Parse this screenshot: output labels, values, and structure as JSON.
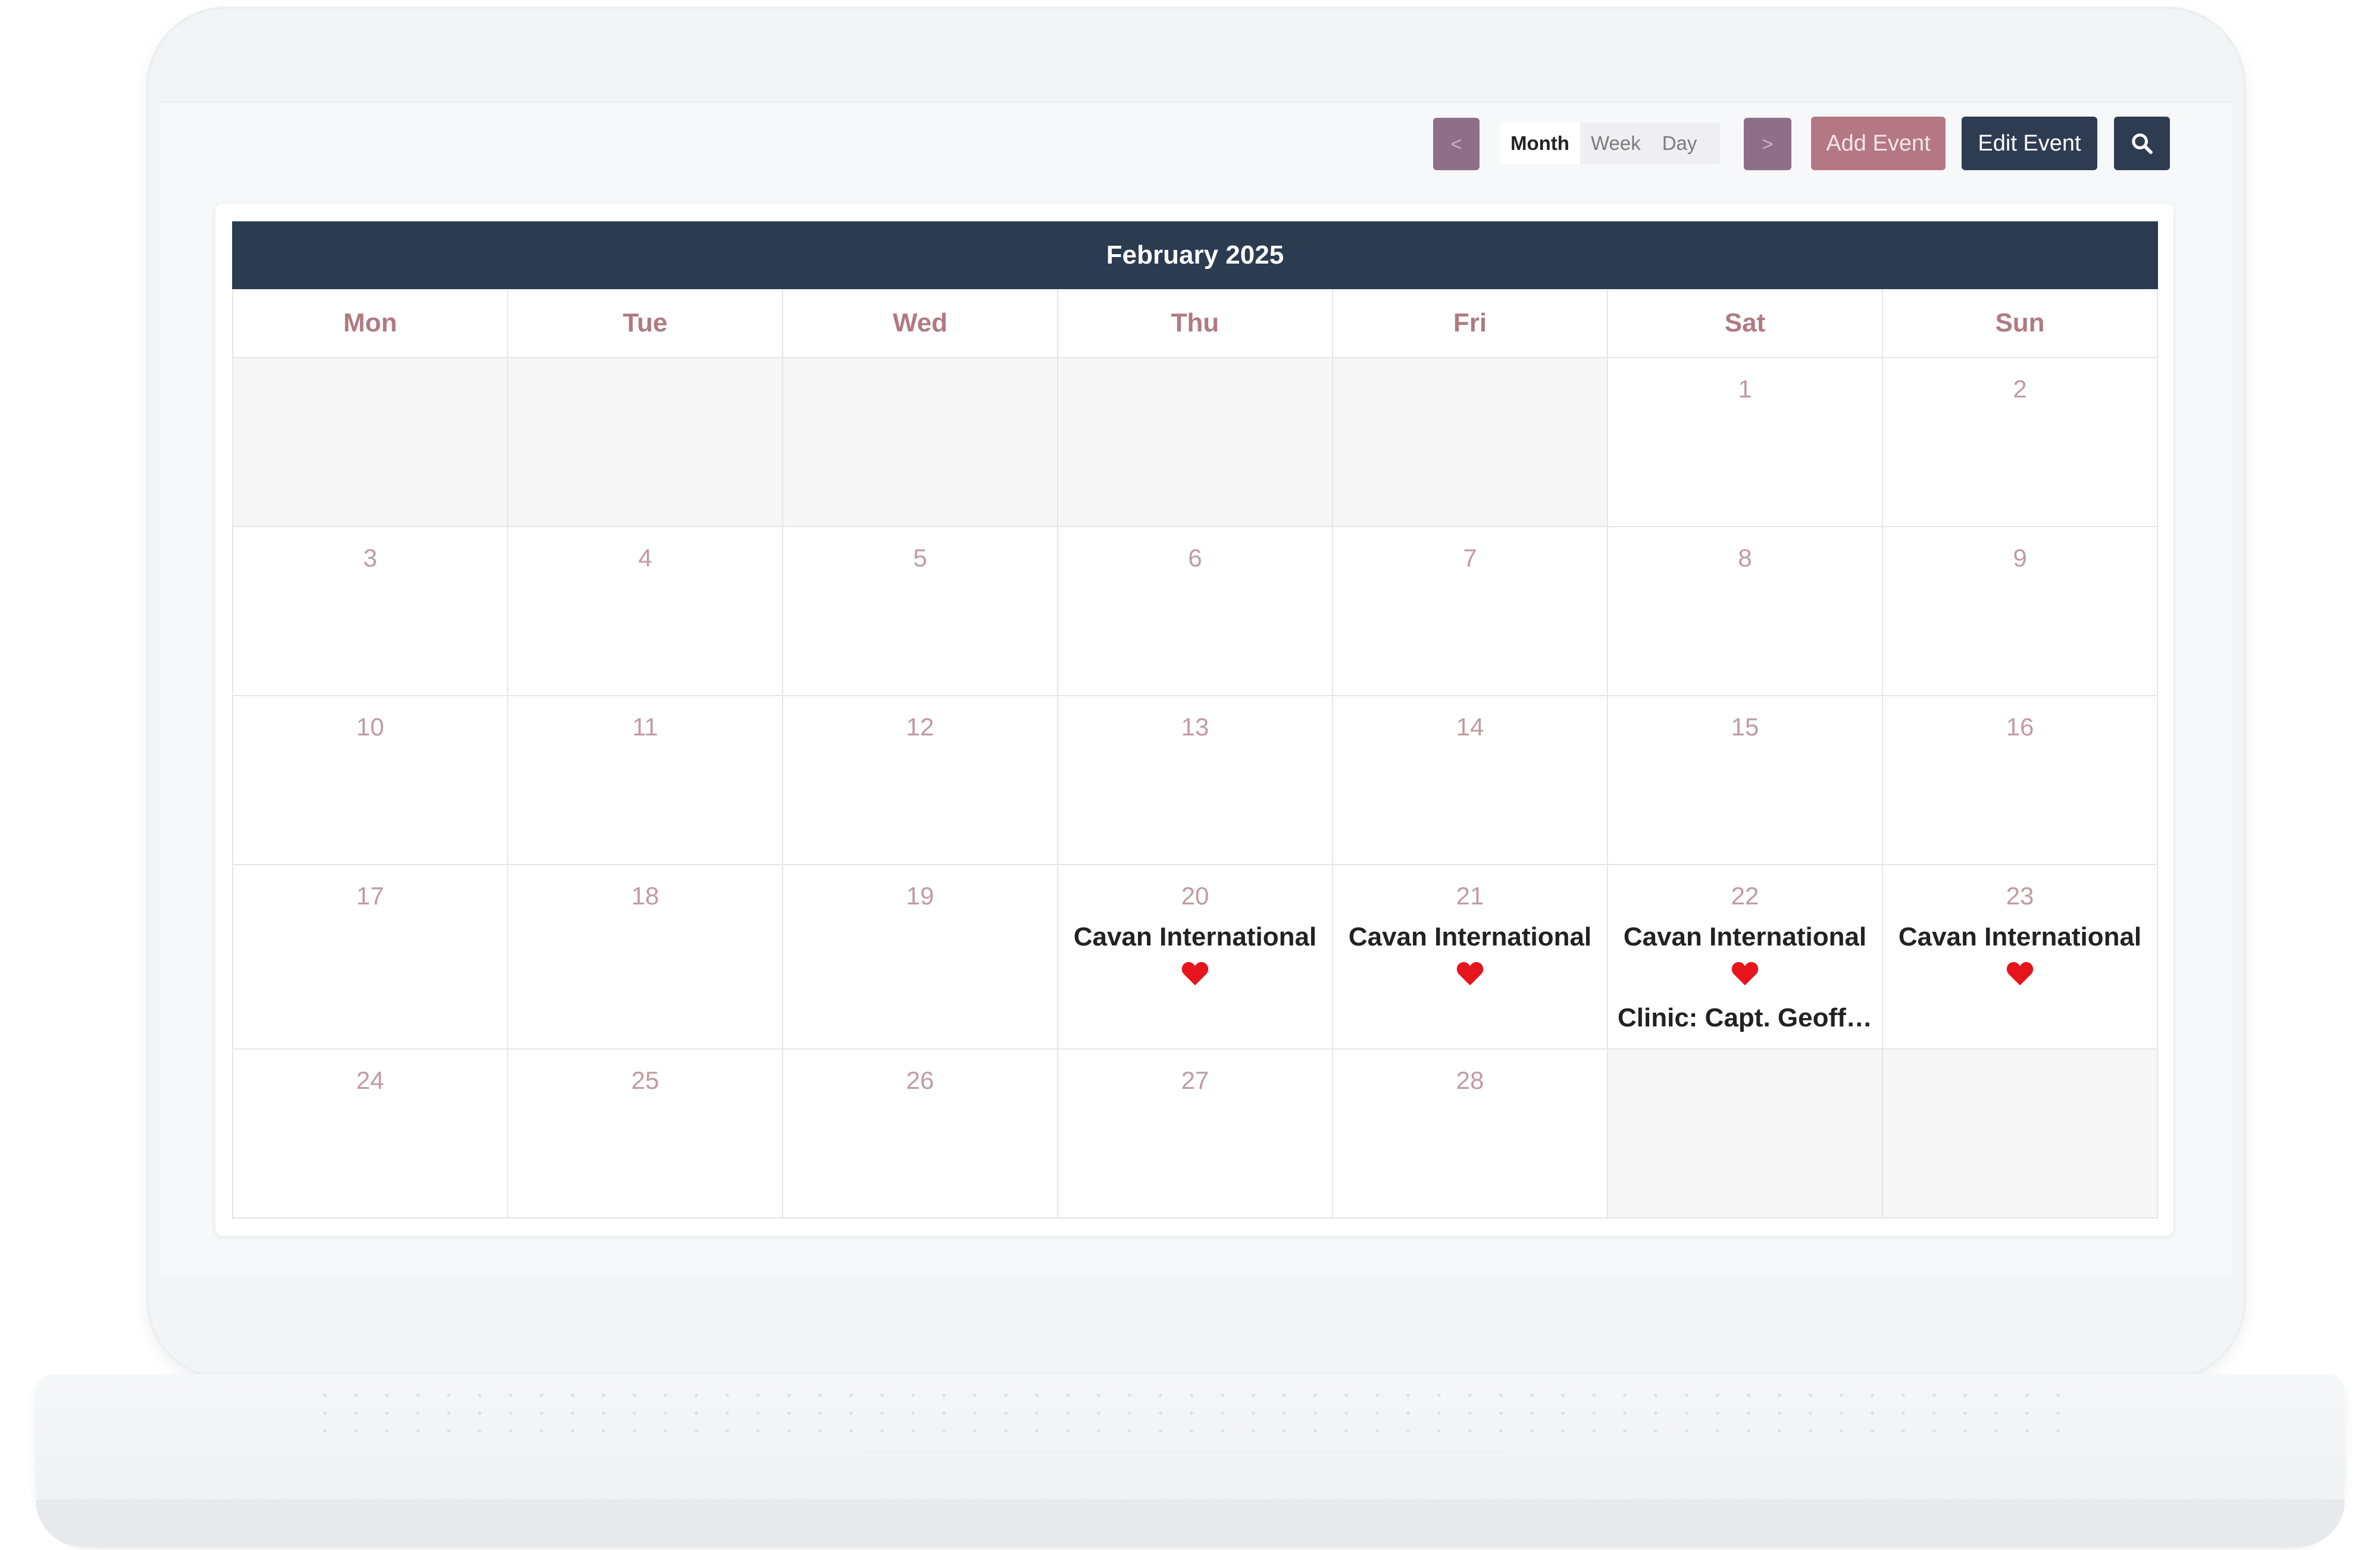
{
  "toolbar": {
    "prev_label": "<",
    "next_label": ">",
    "views": [
      "Month",
      "Week",
      "Day"
    ],
    "active_view": "Month",
    "add_event_label": "Add Event",
    "edit_event_label": "Edit Event",
    "search_icon": "search-icon"
  },
  "calendar": {
    "title": "February 2025",
    "weekdays": [
      "Mon",
      "Tue",
      "Wed",
      "Thu",
      "Fri",
      "Sat",
      "Sun"
    ],
    "weeks": [
      [
        {
          "day": "",
          "empty": true
        },
        {
          "day": "",
          "empty": true
        },
        {
          "day": "",
          "empty": true
        },
        {
          "day": "",
          "empty": true
        },
        {
          "day": "",
          "empty": true
        },
        {
          "day": "1"
        },
        {
          "day": "2"
        }
      ],
      [
        {
          "day": "3"
        },
        {
          "day": "4"
        },
        {
          "day": "5"
        },
        {
          "day": "6"
        },
        {
          "day": "7"
        },
        {
          "day": "8"
        },
        {
          "day": "9"
        }
      ],
      [
        {
          "day": "10"
        },
        {
          "day": "11"
        },
        {
          "day": "12"
        },
        {
          "day": "13"
        },
        {
          "day": "14"
        },
        {
          "day": "15"
        },
        {
          "day": "16"
        }
      ],
      [
        {
          "day": "17"
        },
        {
          "day": "18"
        },
        {
          "day": "19"
        },
        {
          "day": "20",
          "events": [
            "Cavan International"
          ],
          "heart": true
        },
        {
          "day": "21",
          "events": [
            "Cavan International"
          ],
          "heart": true
        },
        {
          "day": "22",
          "events": [
            "Cavan International",
            "Clinic: Capt. Geoff C..."
          ],
          "heart": true
        },
        {
          "day": "23",
          "events": [
            "Cavan International"
          ],
          "heart": true
        }
      ],
      [
        {
          "day": "24"
        },
        {
          "day": "25"
        },
        {
          "day": "26"
        },
        {
          "day": "27"
        },
        {
          "day": "28"
        },
        {
          "day": "",
          "empty": true
        },
        {
          "day": "",
          "empty": true
        }
      ]
    ]
  },
  "colors": {
    "header": "#2b3b50",
    "accent_pink": "#b47884",
    "nav_purple": "#8e6e88",
    "heart": "#e8141c"
  }
}
